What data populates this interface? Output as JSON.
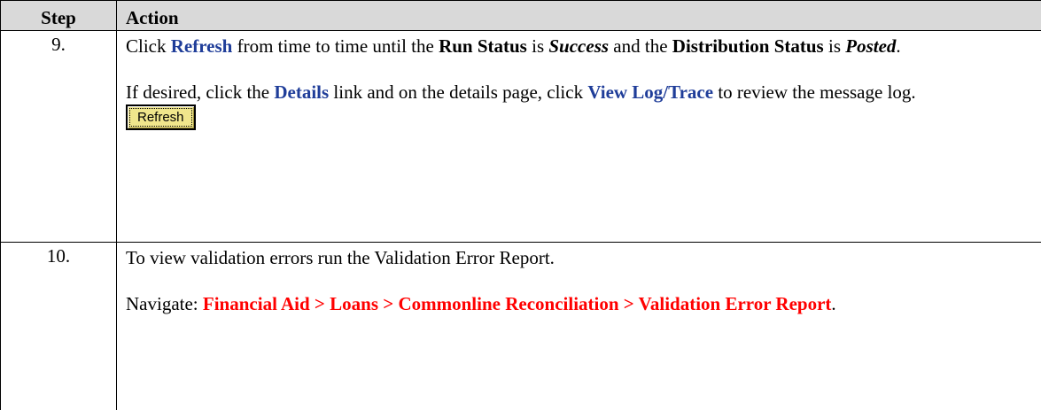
{
  "table": {
    "headers": {
      "step": "Step",
      "action": "Action"
    },
    "rows": [
      {
        "step": "9.",
        "para1": {
          "t1": "Click ",
          "b1": "Refresh",
          "t2": " from time to time until the ",
          "b2": "Run Status",
          "t3": " is ",
          "i1": "Success",
          "t4": " and the ",
          "b3": "Distribution Status",
          "t5": " is ",
          "i2": "Posted",
          "t6": "."
        },
        "para2": {
          "t1": "If desired, click the ",
          "b1": "Details",
          "t2": " link and on the details page, click ",
          "b2": "View Log/Trace",
          "t3": " to review the message log."
        },
        "button_label": "Refresh"
      },
      {
        "step": "10.",
        "para1": "To view validation errors run the Validation Error Report.",
        "para2": {
          "prefix": "Navigate: ",
          "path": "Financial Aid > Loans > Commonline Reconciliation > Validation Error Report",
          "suffix": "."
        }
      }
    ]
  },
  "colors": {
    "header_bg": "#d9d9d9",
    "link_term": "#1f3d99",
    "nav_path": "#ff0000",
    "button_bg": "#f0e68c"
  }
}
